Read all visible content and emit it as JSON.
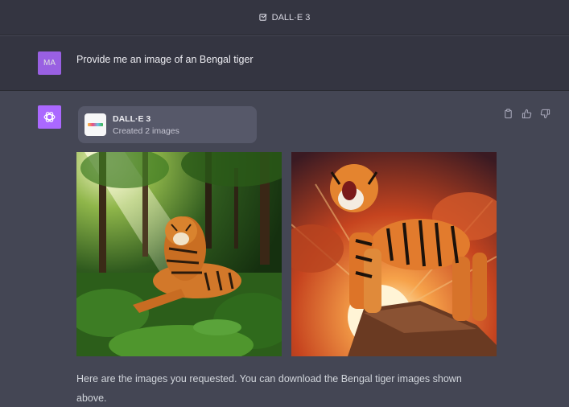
{
  "header": {
    "title": "DALL·E 3",
    "icon": "dalle-edit-icon"
  },
  "user_message": {
    "avatar_initials": "MA",
    "text": "Provide me an image of an Bengal tiger"
  },
  "assistant": {
    "avatar_icon": "openai-logo-icon",
    "tool": {
      "name": "DALL·E 3",
      "status": "Created 2 images"
    },
    "actions": [
      "copy-icon",
      "thumbs-up-icon",
      "thumbs-down-icon"
    ],
    "images": [
      {
        "description_icon": "tiger-forest-image"
      },
      {
        "description_icon": "tiger-roaring-sunset-image"
      }
    ],
    "reply": "Here are the images you requested. You can download the Bengal tiger images shown above."
  },
  "colors": {
    "bg_user": "#343541",
    "bg_assistant": "#444654",
    "avatar": "#ab68ff",
    "card": "#565869"
  }
}
